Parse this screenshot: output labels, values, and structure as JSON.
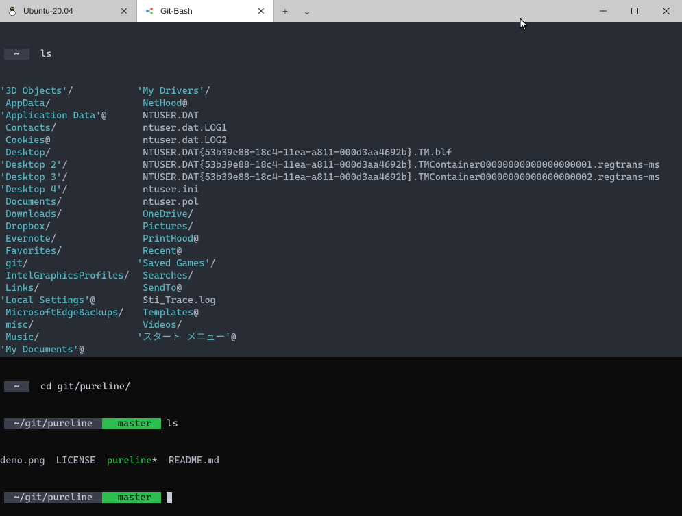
{
  "tabs": {
    "inactive": {
      "title": "Ubuntu-20.04"
    },
    "active": {
      "title": "Git-Bash"
    }
  },
  "controls": {
    "newtab": "+",
    "dropdown": "⌄"
  },
  "prompt1": {
    "seg1": " ~ ",
    "cmd": "ls"
  },
  "listing": {
    "col1": [
      {
        "t": "'3D Objects'",
        "c": "dir",
        "s": "/"
      },
      {
        "t": " AppData",
        "c": "dir",
        "s": "/"
      },
      {
        "t": "'Application Data'",
        "c": "lnk",
        "s": "@"
      },
      {
        "t": " Contacts",
        "c": "dir",
        "s": "/"
      },
      {
        "t": " Cookies",
        "c": "lnk",
        "s": "@"
      },
      {
        "t": " Desktop",
        "c": "dir",
        "s": "/"
      },
      {
        "t": "'Desktop 2'",
        "c": "dir",
        "s": "/"
      },
      {
        "t": "'Desktop 3'",
        "c": "dir",
        "s": "/"
      },
      {
        "t": "'Desktop 4'",
        "c": "dir",
        "s": "/"
      },
      {
        "t": " Documents",
        "c": "dir",
        "s": "/"
      },
      {
        "t": " Downloads",
        "c": "dir",
        "s": "/"
      },
      {
        "t": " Dropbox",
        "c": "dir",
        "s": "/"
      },
      {
        "t": " Evernote",
        "c": "dir",
        "s": "/"
      },
      {
        "t": " Favorites",
        "c": "dir",
        "s": "/"
      },
      {
        "t": " git",
        "c": "dir",
        "s": "/"
      },
      {
        "t": " IntelGraphicsProfiles",
        "c": "dir",
        "s": "/"
      },
      {
        "t": " Links",
        "c": "dir",
        "s": "/"
      },
      {
        "t": "'Local Settings'",
        "c": "lnk",
        "s": "@"
      },
      {
        "t": " MicrosoftEdgeBackups",
        "c": "dir",
        "s": "/"
      },
      {
        "t": " misc",
        "c": "dir",
        "s": "/"
      },
      {
        "t": " Music",
        "c": "dir",
        "s": "/"
      },
      {
        "t": "'My Documents'",
        "c": "lnk",
        "s": "@"
      }
    ],
    "col2": [
      {
        "t": "'My Drivers'",
        "c": "dir",
        "s": "/"
      },
      {
        "t": " NetHood",
        "c": "lnk",
        "s": "@"
      },
      {
        "t": " NTUSER.DAT",
        "c": "plain",
        "s": ""
      },
      {
        "t": " ntuser.dat.LOG1",
        "c": "plain",
        "s": ""
      },
      {
        "t": " ntuser.dat.LOG2",
        "c": "plain",
        "s": ""
      },
      {
        "t": " NTUSER.DAT{53b39e88-18c4-11ea-a811-000d3aa4692b}.TM.blf",
        "c": "plain",
        "s": ""
      },
      {
        "t": " NTUSER.DAT{53b39e88-18c4-11ea-a811-000d3aa4692b}.TMContainer00000000000000000001.regtrans-ms",
        "c": "plain",
        "s": ""
      },
      {
        "t": " NTUSER.DAT{53b39e88-18c4-11ea-a811-000d3aa4692b}.TMContainer00000000000000000002.regtrans-ms",
        "c": "plain",
        "s": ""
      },
      {
        "t": " ntuser.ini",
        "c": "plain",
        "s": ""
      },
      {
        "t": " ntuser.pol",
        "c": "plain",
        "s": ""
      },
      {
        "t": " OneDrive",
        "c": "dir",
        "s": "/"
      },
      {
        "t": " Pictures",
        "c": "dir",
        "s": "/"
      },
      {
        "t": " PrintHood",
        "c": "lnk",
        "s": "@"
      },
      {
        "t": " Recent",
        "c": "lnk",
        "s": "@"
      },
      {
        "t": "'Saved Games'",
        "c": "dir",
        "s": "/"
      },
      {
        "t": " Searches",
        "c": "dir",
        "s": "/"
      },
      {
        "t": " SendTo",
        "c": "lnk",
        "s": "@"
      },
      {
        "t": " Sti_Trace.log",
        "c": "plain",
        "s": ""
      },
      {
        "t": " Templates",
        "c": "lnk",
        "s": "@"
      },
      {
        "t": " Videos",
        "c": "dir",
        "s": "/"
      },
      {
        "t": "'スタート メニュー'",
        "c": "lnk",
        "s": "@"
      },
      {
        "t": "",
        "c": "plain",
        "s": ""
      }
    ]
  },
  "prompt2": {
    "seg1": " ~ ",
    "cmd": "cd git/pureline/"
  },
  "prompt3": {
    "seg1": " ~/git/pureline ",
    "seg2": "  master ",
    "cmd": "ls"
  },
  "listing2": "demo.png  LICENSE  pureline*  README.md",
  "listing2_parts": {
    "a": "demo.png  LICENSE  ",
    "b": "pureline",
    "bs": "*",
    "c": "  README.md"
  },
  "prompt4": {
    "seg1": " ~/git/pureline ",
    "seg2": "  master "
  },
  "branch_icon": ""
}
